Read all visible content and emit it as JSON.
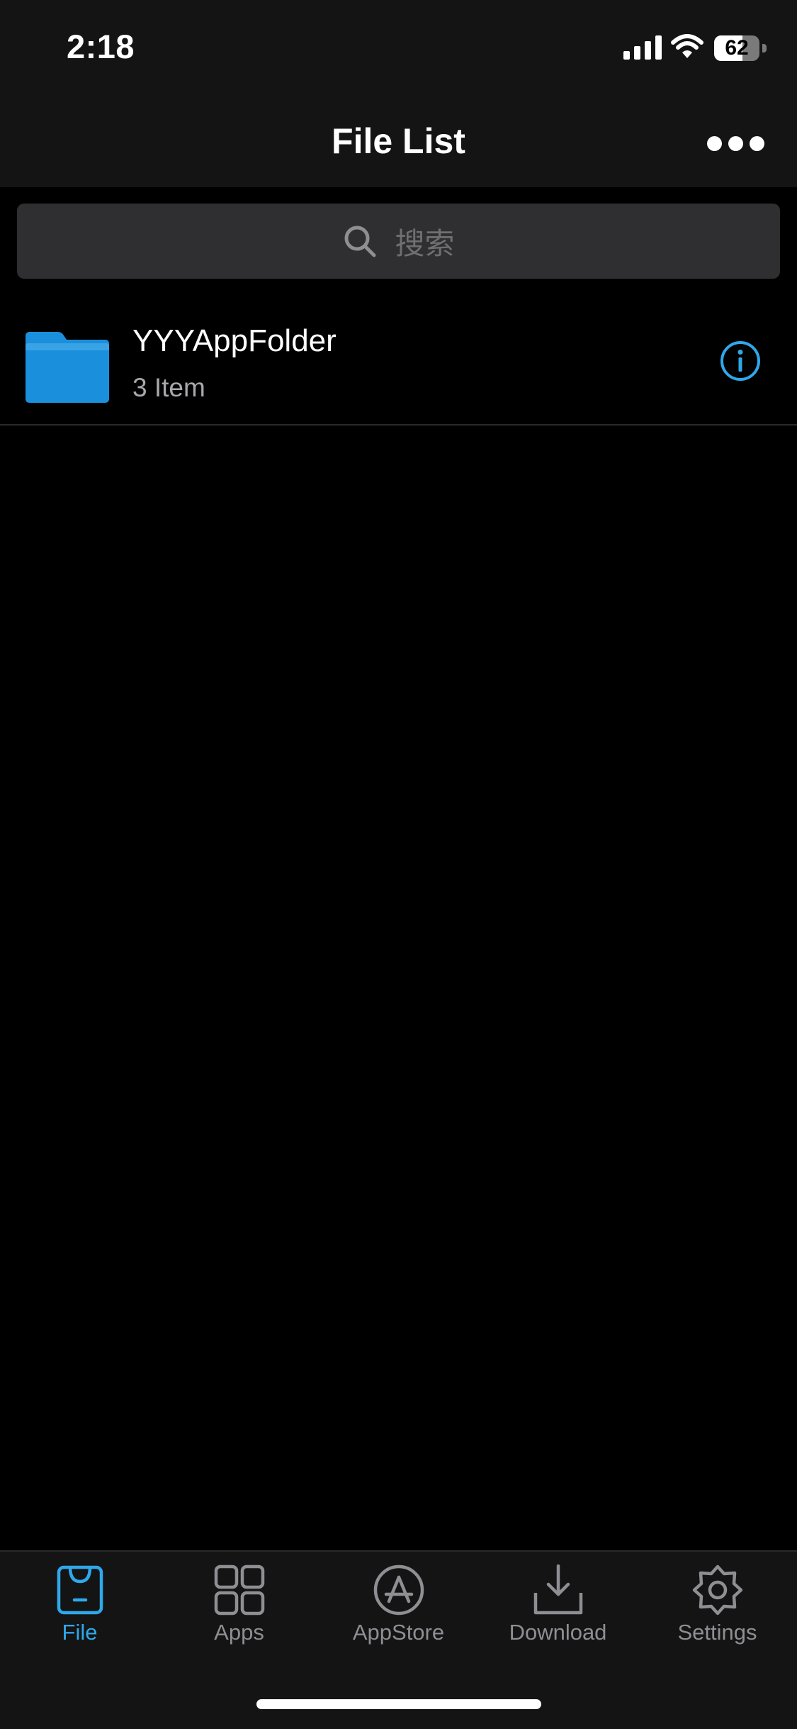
{
  "status_bar": {
    "time": "2:18",
    "battery_level": "62",
    "battery_fraction": 0.62
  },
  "nav": {
    "title": "File List",
    "more_icon": "more-horizontal-icon"
  },
  "search": {
    "placeholder": "搜索",
    "icon": "search-icon"
  },
  "files": [
    {
      "name": "YYYAppFolder",
      "count": "3 Item",
      "icon": "folder-icon",
      "action_icon": "info-icon"
    }
  ],
  "tabs": [
    {
      "label": "File",
      "icon": "file-bag-icon",
      "active": true
    },
    {
      "label": "Apps",
      "icon": "apps-grid-icon",
      "active": false
    },
    {
      "label": "AppStore",
      "icon": "appstore-icon",
      "active": false
    },
    {
      "label": "Download",
      "icon": "download-icon",
      "active": false
    },
    {
      "label": "Settings",
      "icon": "settings-gear-icon",
      "active": false
    }
  ],
  "colors": {
    "accent": "#2fa8ea",
    "folder": "#1a8fdc",
    "background": "#000000",
    "bar_background": "#141414",
    "inactive": "#8e8e93"
  }
}
